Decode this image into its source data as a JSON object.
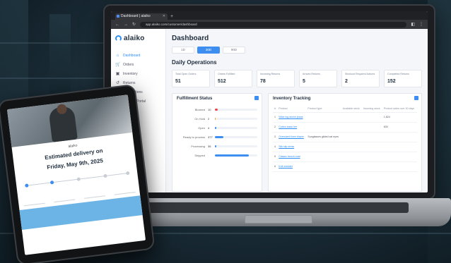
{
  "browser": {
    "tab_title": "Dashboard | alaiko",
    "url": "app.alaiko.com/customer/dashboard"
  },
  "app": {
    "logo_text": "alaiko",
    "sidebar": {
      "items": [
        {
          "label": "Dashboard",
          "icon": "home-icon",
          "active": true
        },
        {
          "label": "Orders",
          "icon": "cart-icon",
          "active": false
        },
        {
          "label": "Inventory",
          "icon": "box-icon",
          "active": false
        },
        {
          "label": "Returns",
          "icon": "return-icon",
          "active": false
        },
        {
          "label": "Automations",
          "icon": "automation-icon",
          "active": false
        },
        {
          "label": "Support Portal",
          "icon": "support-icon",
          "active": false
        }
      ]
    },
    "page_title": "Dashboard",
    "period_tabs": [
      {
        "label": "1D",
        "active": false
      },
      {
        "label": "30D",
        "active": true
      },
      {
        "label": "90D",
        "active": false
      }
    ],
    "daily_operations": {
      "title": "Daily Operations",
      "stats": [
        {
          "label": "Total Open Orders",
          "value": "51"
        },
        {
          "label": "Orders Fulfilled",
          "value": "512"
        },
        {
          "label": "Incoming Returns",
          "value": "78"
        },
        {
          "label": "Arrived Returns",
          "value": "5"
        },
        {
          "label": "Stockout Required Actions",
          "value": "2"
        },
        {
          "label": "Completed Returns",
          "value": "152"
        }
      ]
    },
    "fulfillment": {
      "title": "Fulfillment Status",
      "rows": [
        {
          "label": "Blocked",
          "value": "10",
          "fraction": 0.06,
          "color": "#e5484d"
        },
        {
          "label": "On Hold",
          "value": "2",
          "fraction": 0.02,
          "color": "#f5a524"
        },
        {
          "label": "Open",
          "value": "4",
          "fraction": 0.03,
          "color": "#3d8ef0"
        },
        {
          "label": "Ready to process",
          "value": "377",
          "fraction": 0.2,
          "color": "#3d8ef0"
        },
        {
          "label": "Processing",
          "value": "35",
          "fraction": 0.04,
          "color": "#3d8ef0"
        },
        {
          "label": "Shipped",
          "value": "",
          "fraction": 0.8,
          "color": "#3d8ef0"
        }
      ]
    },
    "inventory": {
      "title": "Inventory Tracking",
      "columns": [
        "#",
        "Product",
        "Product type",
        "Available stock",
        "Incoming stock",
        "Product sales over 30 days"
      ],
      "rows": [
        {
          "num": "1",
          "product": "Wide leg denim jeans",
          "type": "",
          "available": "",
          "incoming": "",
          "sales": "1,824"
        },
        {
          "num": "2",
          "product": "Cotton basic tee",
          "type": "",
          "available": "",
          "incoming": "",
          "sales": "830"
        },
        {
          "num": "3",
          "product": "Oversized linen blazer",
          "type": "Sunglasses gilded cat eyes",
          "available": "",
          "incoming": "",
          "sales": ""
        },
        {
          "num": "4",
          "product": "Silk slip dress",
          "type": "",
          "available": "",
          "incoming": "",
          "sales": ""
        },
        {
          "num": "5",
          "product": "Classic trench coat",
          "type": "",
          "available": "",
          "incoming": "",
          "sales": ""
        },
        {
          "num": "6",
          "product": "Knit sweater",
          "type": "",
          "available": "",
          "incoming": "",
          "sales": ""
        }
      ]
    }
  },
  "tablet": {
    "logo_text": "alaiko",
    "heading_line1": "Estimated delivery on",
    "heading_line2": "Friday, May 9th, 2025",
    "footer_text": ""
  }
}
